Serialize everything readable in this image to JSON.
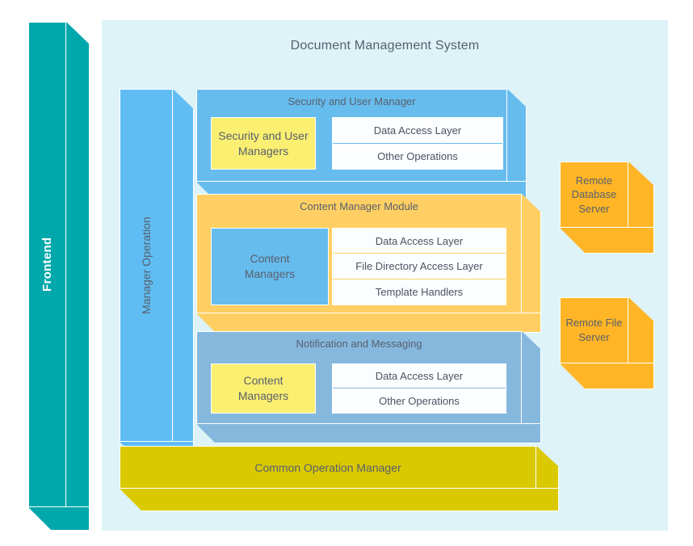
{
  "diagram": {
    "title": "Document Management System",
    "background_color": "#ddf3f8",
    "text_color": "#57606c"
  },
  "frontend": {
    "label": "Frontend",
    "color": "#00a8ab"
  },
  "manager_operation": {
    "label": "Manager Operation",
    "color": "#60bdf3"
  },
  "modules": [
    {
      "title": "Security and User Manager",
      "color": "#67bcee",
      "manager": {
        "label": "Security and User Managers",
        "line1": "Security and User",
        "line2": "Managers",
        "color": "#fbef72"
      },
      "layers": [
        "Data Access Layer",
        "Other Operations"
      ]
    },
    {
      "title": "Content Manager Module",
      "color": "#ffcf64",
      "manager": {
        "label": "Content Managers",
        "line1": "Content",
        "line2": "Managers",
        "color": "#67bcee"
      },
      "layers": [
        "Data Access Layer",
        "File Directory Access Layer",
        "Template Handlers"
      ]
    },
    {
      "title": "Notification and Messaging",
      "color": "#86b8de",
      "manager": {
        "label": "Content Managers",
        "line1": "Content",
        "line2": "Managers",
        "color": "#fbef72"
      },
      "layers": [
        "Data Access Layer",
        "Other Operations"
      ]
    }
  ],
  "common_operation": {
    "label": "Common Operation Manager",
    "color": "#dac900"
  },
  "remote_servers": [
    {
      "line1": "Remote",
      "line2": "Database",
      "line3": "Server",
      "label": "Remote Database Server",
      "color": "#ffb526"
    },
    {
      "line1": "Remote File",
      "line2": "Server",
      "line3": "",
      "label": "Remote File Server",
      "color": "#ffb526"
    }
  ]
}
